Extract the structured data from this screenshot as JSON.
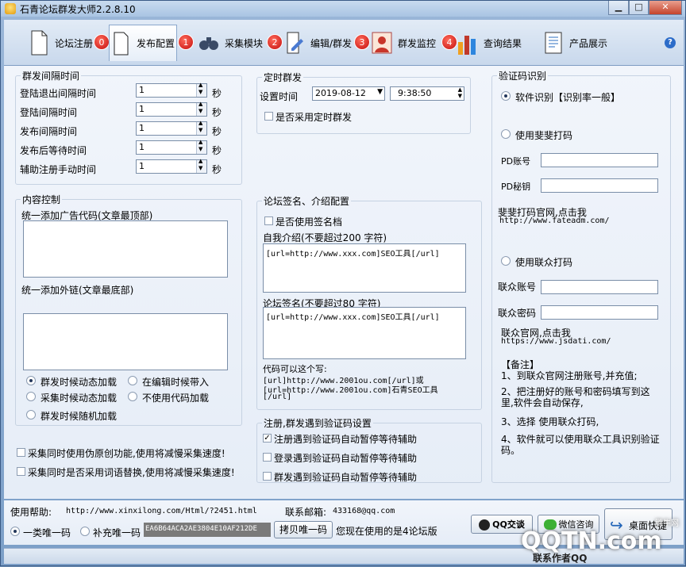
{
  "window": {
    "title": "石青论坛群发大师2.2.8.10",
    "controls": [
      "minimize",
      "maximize",
      "close"
    ]
  },
  "toolbar": {
    "tabs": [
      {
        "label": "论坛注册",
        "icon": "document-icon",
        "badge": "0"
      },
      {
        "label": "发布配置",
        "icon": "page-icon",
        "badge": "1"
      },
      {
        "label": "采集模块",
        "icon": "binoculars-icon",
        "badge": "2"
      },
      {
        "label": "编辑/群发",
        "icon": "edit-icon",
        "badge": "3"
      },
      {
        "label": "群发监控",
        "icon": "user-monitor-icon",
        "badge": "4"
      },
      {
        "label": "查询结果",
        "icon": "bar-chart-icon",
        "badge": ""
      },
      {
        "label": "产品展示",
        "icon": "catalog-icon",
        "badge": ""
      }
    ],
    "active": "发布配置",
    "help": "?"
  },
  "intervals": {
    "legend": "群发间隔时间",
    "rows": [
      {
        "label": "登陆退出间隔时间",
        "value": "1",
        "unit": "秒"
      },
      {
        "label": "登陆间隔时间",
        "value": "1",
        "unit": "秒"
      },
      {
        "label": "发布间隔时间",
        "value": "1",
        "unit": "秒"
      },
      {
        "label": "发布后等待时间",
        "value": "1",
        "unit": "秒"
      },
      {
        "label": "辅助注册手动时间",
        "value": "1",
        "unit": "秒"
      }
    ]
  },
  "schedule": {
    "legend": "定时群发",
    "time_label": "设置时间",
    "date": "2019-08-12",
    "time": "9:38:50",
    "use_schedule_label": "是否采用定时群发"
  },
  "content": {
    "legend": "内容控制",
    "ad_label": "统一添加广告代码(文章最顶部)",
    "ad_value": "",
    "link_label": "统一添加外链(文章最底部)",
    "link_value": "",
    "options": [
      {
        "label": "群发时候动态加载",
        "checked": true
      },
      {
        "label": "在编辑时候带入",
        "checked": false
      },
      {
        "label": "采集时候动态加载",
        "checked": false
      },
      {
        "label": "不使用代码加载",
        "checked": false
      },
      {
        "label": "群发时候随机加载",
        "checked": false
      }
    ]
  },
  "signature": {
    "legend": "论坛签名、介绍配置",
    "use_sig_label": "是否使用签名档",
    "intro_label": "自我介绍(不要超过200 字符)",
    "intro_value": "[url=http://www.xxx.com]SEO工具[/url]",
    "sig_label": "论坛签名(不要超过80 字符)",
    "sig_value": "[url=http://www.xxx.com]SEO工具[/url]",
    "hint_line1": "代码可以这个写:",
    "hint_line2": "[url]http://www.2001ou.com[/url]或",
    "hint_line3": "[url=http://www.2001ou.com]石青SEO工具",
    "hint_line4": "[/url]"
  },
  "captcha_settings": {
    "legend": "注册,群发遇到验证码设置",
    "options": [
      {
        "label": "注册遇到验证码自动暂停等待辅助",
        "checked": true
      },
      {
        "label": "登录遇到验证码自动暂停等待辅助",
        "checked": false
      },
      {
        "label": "群发遇到验证码自动暂停等待辅助",
        "checked": false
      }
    ]
  },
  "misc_options": [
    {
      "label": "采集同时使用伪原创功能,使用将减慢采集速度!",
      "checked": false
    },
    {
      "label": "采集同时是否采用词语替换,使用将减慢采集速度!",
      "checked": false
    }
  ],
  "captcha_recognition": {
    "legend": "验证码识别",
    "software_label": "软件识别【识别率一般】",
    "fatea_label": "使用斐斐打码",
    "pd_account_label": "PD账号",
    "pd_account_value": "",
    "pd_key_label": "PD秘钥",
    "pd_key_value": "",
    "fatea_site_label": "斐斐打码官网,点击我",
    "fatea_url": "http://www.fateadm.com/",
    "lianzhong_label": "使用联众打码",
    "lz_account_label": "联众账号",
    "lz_account_value": "",
    "lz_password_label": "联众密码",
    "lz_password_value": "",
    "lz_site_label": "联众官网,点击我",
    "lz_url": "https://www.jsdati.com/",
    "notes_title": "【备注】",
    "notes": [
      "1、到联众官网注册账号,并充值;",
      "2、把注册好的账号和密码填写到这里,软件会自动保存,",
      "3、选择 使用联众打码,",
      "4、软件就可以使用联众工具识别验证码。"
    ],
    "selected": "software"
  },
  "footer": {
    "help_label": "使用帮助:",
    "help_url": "http://www.xinxilong.com/Html/?2451.html",
    "email_label": "联系邮箱:",
    "email": "433168@qq.com",
    "unique_type1": "一类唯一码",
    "unique_type2": "补充唯一码",
    "unique_code": "EA6B64ACA2AE3804E10AF212DE",
    "copy_button": "拷贝唯一码",
    "forum_status": "您现在使用的是4论坛版",
    "qq_button": "QQ交谈",
    "wechat_button": "微信咨询",
    "desktop_button": "桌面快捷",
    "contact_author": "联系作者QQ"
  },
  "watermark": {
    "text": "QQTN.com",
    "sub": "腾牛网"
  }
}
